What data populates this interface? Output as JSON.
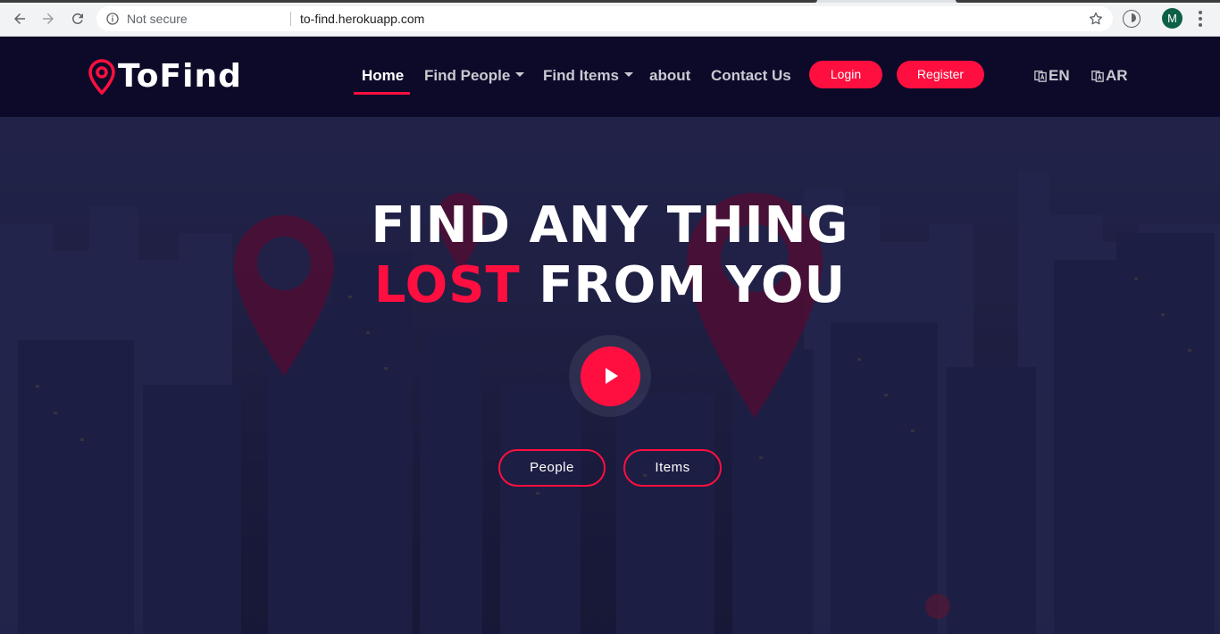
{
  "browser": {
    "security_label": "Not secure",
    "url": "to-find.herokuapp.com",
    "profile_initial": "M"
  },
  "site": {
    "brand": "ToFind",
    "nav": {
      "home": "Home",
      "find_people": "Find People",
      "find_items": "Find Items",
      "about": "about",
      "contact": "Contact Us"
    },
    "login_label": "Login",
    "register_label": "Register",
    "lang_en": "EN",
    "lang_ar": "AR"
  },
  "hero": {
    "line1": "FIND ANY THING",
    "line2_highlight": "LOST",
    "line2_rest": "FROM YOU",
    "people_label": "People",
    "items_label": "Items"
  },
  "colors": {
    "accent": "#fe0f3f",
    "navbar_bg": "#0d0a29"
  },
  "icons": [
    "back-icon",
    "forward-icon",
    "reload-icon",
    "info-icon",
    "star-icon",
    "extension-icon",
    "menu-icon",
    "location-pin-icon",
    "translate-icon",
    "play-icon"
  ]
}
